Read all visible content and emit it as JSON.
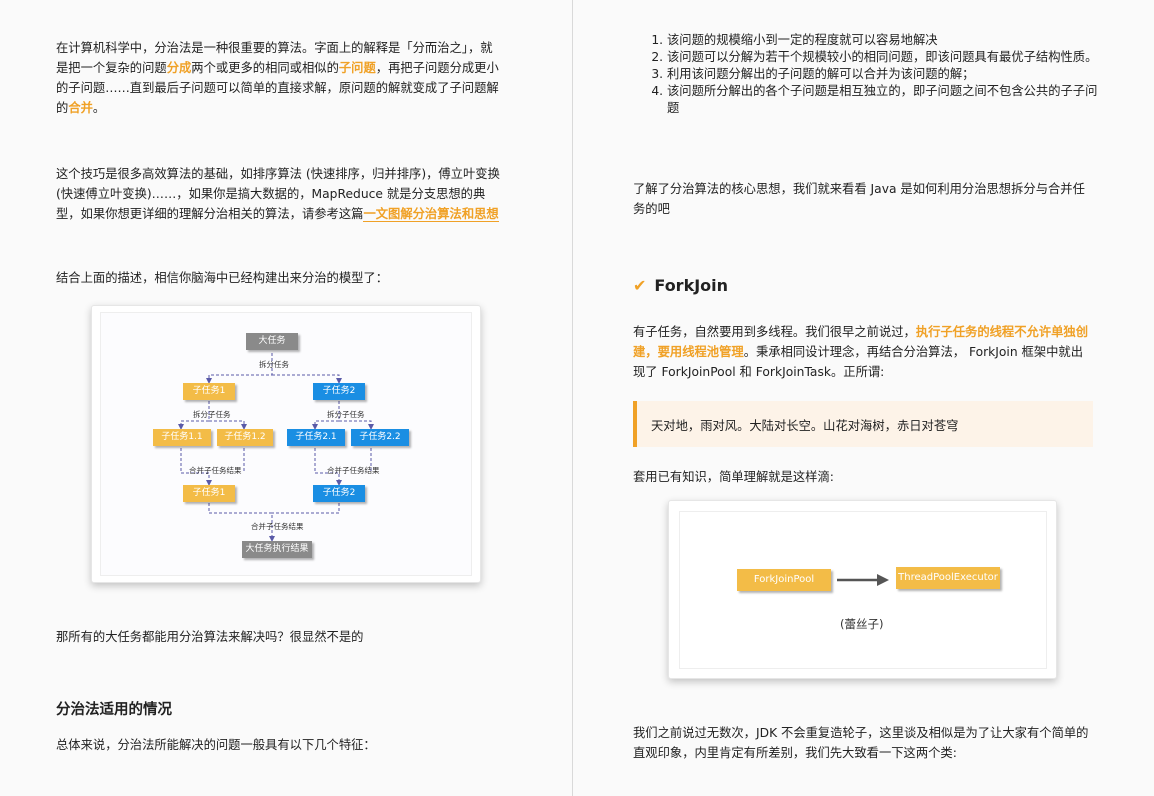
{
  "left": {
    "para1_a": "在计算机科学中，分治法是一种很重要的算法。字面上的解释是「分而治之」，就是把一个复杂的问题",
    "para1_hl1": "分成",
    "para1_b": "两个或更多的相同或相似的",
    "para1_hl2": "子问题",
    "para1_c": "，再把子问题分成更小的子问题……直到最后子问题可以简单的直接求解，原问题的解就变成了子问题解的",
    "para1_hl3": "合并",
    "para1_d": "。",
    "para2_a": "这个技巧是很多高效算法的基础，如排序算法 (快速排序，归并排序)，傅立叶变换 (快速傅立叶变换)……，如果你是搞大数据的，MapReduce 就是分支思想的典型，如果你想更详细的理解分治相关的算法，请参考这篇",
    "para2_link": "一文图解分治算法和思想",
    "para3": "结合上面的描述，相信你脑海中已经构建出来分治的模型了：",
    "diagram": {
      "top": "大任务",
      "split1": "拆分任务",
      "sub1": "子任务1",
      "sub2": "子任务2",
      "split2": "拆分子任务",
      "split3": "拆分子任务",
      "s11": "子任务1.1",
      "s12": "子任务1.2",
      "s21": "子任务2.1",
      "s22": "子任务2.2",
      "merge1": "合并子任务结果",
      "merge2": "合并子任务结果",
      "r1": "子任务1",
      "r2": "子任务2",
      "merge3": "合并子任务结果",
      "bottom": "大任务执行结果"
    },
    "para4": "那所有的大任务都能用分治算法来解决吗？很显然不是的",
    "heading": "分治法适用的情况",
    "para5": "总体来说，分治法所能解决的问题一般具有以下几个特征："
  },
  "right": {
    "list": [
      "该问题的规模缩小到一定的程度就可以容易地解决",
      "该问题可以分解为若干个规模较小的相同问题，即该问题具有最优子结构性质。",
      "利用该问题分解出的子问题的解可以合并为该问题的解；",
      "该问题所分解出的各个子问题是相互独立的，即子问题之间不包含公共的子子问题"
    ],
    "para1": "了解了分治算法的核心思想，我们就来看看 Java 是如何利用分治思想拆分与合并任务的吧",
    "heading_icon": "✔",
    "heading": "ForkJoin",
    "para2_a": "有子任务，自然要用到多线程。我们很早之前说过，",
    "para2_hl": "执行子任务的线程不允许单独创建，要用线程池管理",
    "para2_b": "。秉承相同设计理念，再结合分治算法， ForkJoin 框架中就出现了 ForkJoinPool 和 ForkJoinTask。正所谓:",
    "quote": "天对地，雨对风。大陆对长空。山花对海树，赤日对苍穹",
    "para3": "套用已有知识，简单理解就是这样滴:",
    "fig2_left": "ForkJoinPool",
    "fig2_right": "ThreadPoolExecutor",
    "fig2_caption": "(蕾丝子)",
    "para4": "我们之前说过无数次，JDK 不会重复造轮子，这里谈及相似是为了让大家有个简单的直观印象，内里肯定有所差别，我们先大致看一下这两个类:"
  },
  "colors": {
    "accent": "#f0a126",
    "blue": "#1a8ee3",
    "yellow": "#f3bc47",
    "gray": "#8a8a8a"
  }
}
